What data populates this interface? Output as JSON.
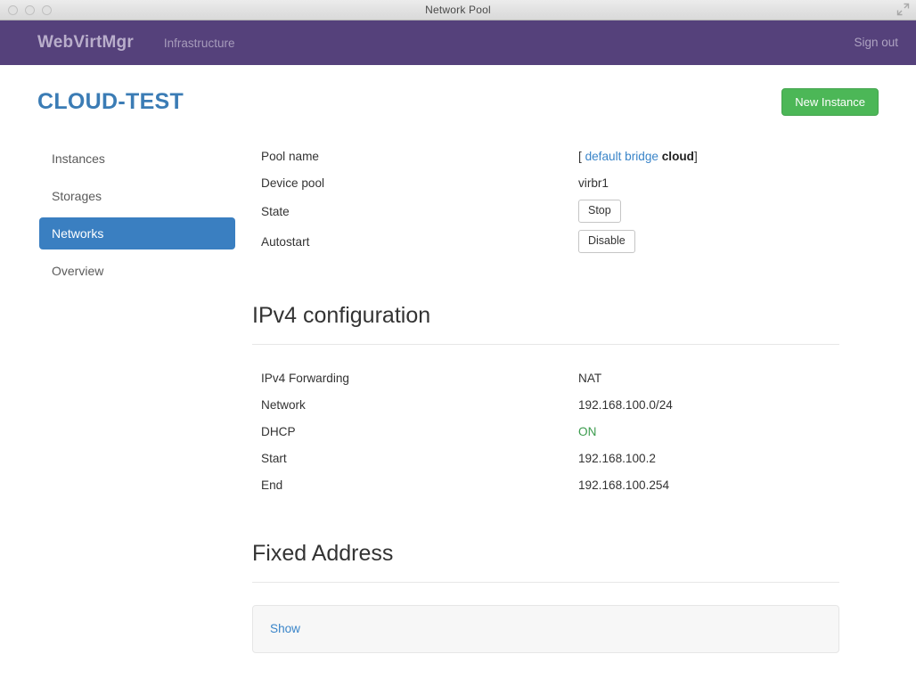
{
  "window": {
    "title": "Network Pool",
    "controls": [
      "close",
      "minimize",
      "zoom"
    ],
    "resize_icon": "resize-icon"
  },
  "navbar": {
    "brand": "WebVirtMgr",
    "links": [
      {
        "label": "Infrastructure",
        "name": "nav-link-infrastructure"
      }
    ],
    "sign_out": "Sign out",
    "background_color": "#55417b"
  },
  "header": {
    "title": "CLOUD-TEST",
    "title_color": "#3b7cb5",
    "new_instance_button": "New Instance",
    "new_instance_color": "#4cb757"
  },
  "sidebar": {
    "items": [
      {
        "label": "Instances",
        "active": false
      },
      {
        "label": "Storages",
        "active": false
      },
      {
        "label": "Networks",
        "active": true
      },
      {
        "label": "Overview",
        "active": false
      }
    ],
    "active_color": "#3a7fc1"
  },
  "pool": {
    "rows": [
      {
        "label": "Pool name"
      },
      {
        "label": "Device pool",
        "value": "virbr1"
      },
      {
        "label": "State"
      },
      {
        "label": "Autostart"
      }
    ],
    "pool_name": {
      "open_bracket": "[",
      "link": "default bridge",
      "bold": "cloud",
      "close_bracket": "]"
    },
    "device_pool": "virbr1",
    "state_button": "Stop",
    "autostart_button": "Disable"
  },
  "ipv4": {
    "heading": "IPv4 configuration",
    "rows": [
      {
        "label": "IPv4 Forwarding",
        "value": "NAT"
      },
      {
        "label": "Network",
        "value": "192.168.100.0/24"
      },
      {
        "label": "DHCP",
        "value": "ON"
      },
      {
        "label": "Start",
        "value": "192.168.100.2"
      },
      {
        "label": "End",
        "value": "192.168.100.254"
      }
    ],
    "dhcp_on_color": "#3c9c4e"
  },
  "fixed_address": {
    "heading": "Fixed Address",
    "show_link": "Show"
  }
}
